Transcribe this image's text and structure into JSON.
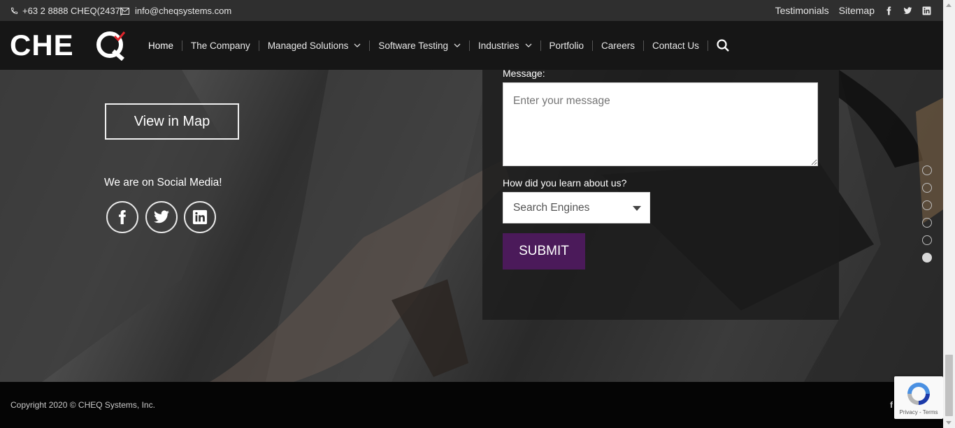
{
  "topbar": {
    "phone": "+63 2 8888 CHEQ(2437)",
    "email": "info@cheqsystems.com",
    "links": [
      "Testimonials",
      "Sitemap"
    ],
    "social_icons": [
      "facebook-icon",
      "twitter-icon",
      "linkedin-icon"
    ]
  },
  "header": {
    "logo_text": "CHEQ",
    "nav": [
      {
        "label": "Home",
        "dropdown": false
      },
      {
        "label": "The Company",
        "dropdown": false
      },
      {
        "label": "Managed Solutions",
        "dropdown": true
      },
      {
        "label": "Software Testing",
        "dropdown": true
      },
      {
        "label": "Industries",
        "dropdown": true
      },
      {
        "label": "Portfolio",
        "dropdown": false
      },
      {
        "label": "Careers",
        "dropdown": false
      },
      {
        "label": "Contact Us",
        "dropdown": false
      }
    ]
  },
  "hero": {
    "view_map_label": "View in Map",
    "social_title": "We are on Social Media!"
  },
  "form": {
    "message_label": "Message:",
    "message_placeholder": "Enter your message",
    "learn_label": "How did you learn about us?",
    "learn_selected": "Search Engines",
    "submit_label": "SUBMIT"
  },
  "side_nav": {
    "count": 6,
    "active_index": 5
  },
  "footer": {
    "copyright": "Copyright 2020 © CHEQ Systems, Inc.",
    "footer_icon_glyph": "f"
  },
  "recaptcha": {
    "text": "Privacy - Terms"
  },
  "colors": {
    "submit_bg": "#4b1a5a",
    "header_bg": "#161616",
    "topbar_bg": "#2f2f2f",
    "footer_bg": "#050505"
  }
}
